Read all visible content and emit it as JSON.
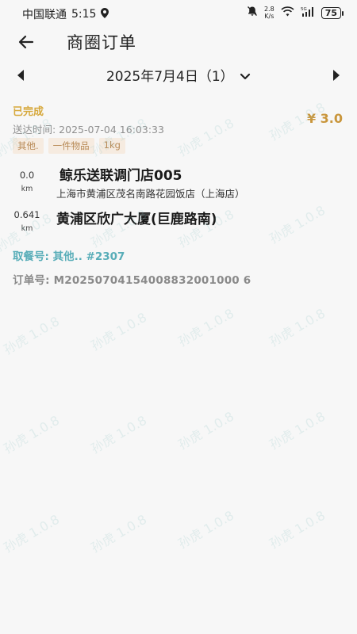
{
  "status_bar": {
    "carrier": "中国联通",
    "time": "5:15",
    "net_speed_value": "2.8",
    "net_speed_unit": "K/s",
    "battery": "75"
  },
  "header": {
    "title": "商圈订单"
  },
  "date_nav": {
    "label": "2025年7月4日（1）"
  },
  "order": {
    "status": "已完成",
    "price": "¥ 3.0",
    "deliver_time": "送达时间: 2025-07-04 16:03:33",
    "tags": [
      "其他.",
      "一件物品",
      "1kg"
    ],
    "pickup": {
      "distance": "0.0",
      "unit": "km",
      "name": "鲸乐送联调门店005",
      "address": "上海市黄浦区茂名南路花园饭店（上海店）"
    },
    "dropoff": {
      "distance": "0.641",
      "unit": "km",
      "name": "黄浦区欣广大厦(巨鹿路南)"
    },
    "pickup_code": "取餐号: 其他.. #2307",
    "order_number": "订单号: M20250704154008832001000 6"
  },
  "watermark": "孙虎 1.0.8",
  "colors": {
    "status": "#d7a93d",
    "price": "#c9963c",
    "pickup_code": "#58adb8",
    "tag_bg": "#f6ebe0"
  }
}
